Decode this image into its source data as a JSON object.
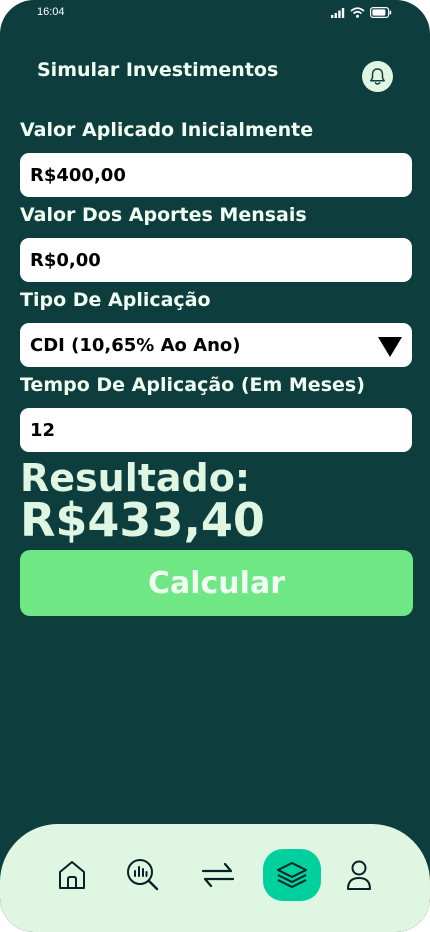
{
  "status_bar": {
    "time": "16:04",
    "icons": [
      "signal-icon",
      "wifi-icon",
      "battery-icon"
    ]
  },
  "header": {
    "title": "Simular Investimentos",
    "notification_icon": "bell-icon"
  },
  "form": {
    "initial_value": {
      "label": "Valor Aplicado Inicialmente",
      "value": "R$400,00"
    },
    "monthly_contribution": {
      "label": "Valor Dos Aportes Mensais",
      "value": "R$0,00"
    },
    "application_type": {
      "label": "Tipo De Aplicação",
      "selected": "CDI (10,65% Ao Ano)"
    },
    "duration": {
      "label": "Tempo De Aplicação (Em Meses)",
      "value": "12"
    }
  },
  "result": {
    "label": "Resultado:",
    "value": "R$433,40"
  },
  "calculate_button": {
    "label": "Calcular"
  },
  "bottom_nav": {
    "items": [
      {
        "icon": "home-icon",
        "active": false
      },
      {
        "icon": "analysis-icon",
        "active": false
      },
      {
        "icon": "transfer-icon",
        "active": false
      },
      {
        "icon": "layers-icon",
        "active": true
      },
      {
        "icon": "profile-icon",
        "active": false
      }
    ]
  },
  "colors": {
    "background": "#0e3d3d",
    "text_light": "#f1fff3",
    "accent_light": "#dff7e2",
    "button": "#6ee784",
    "nav_active": "#00d09e"
  }
}
